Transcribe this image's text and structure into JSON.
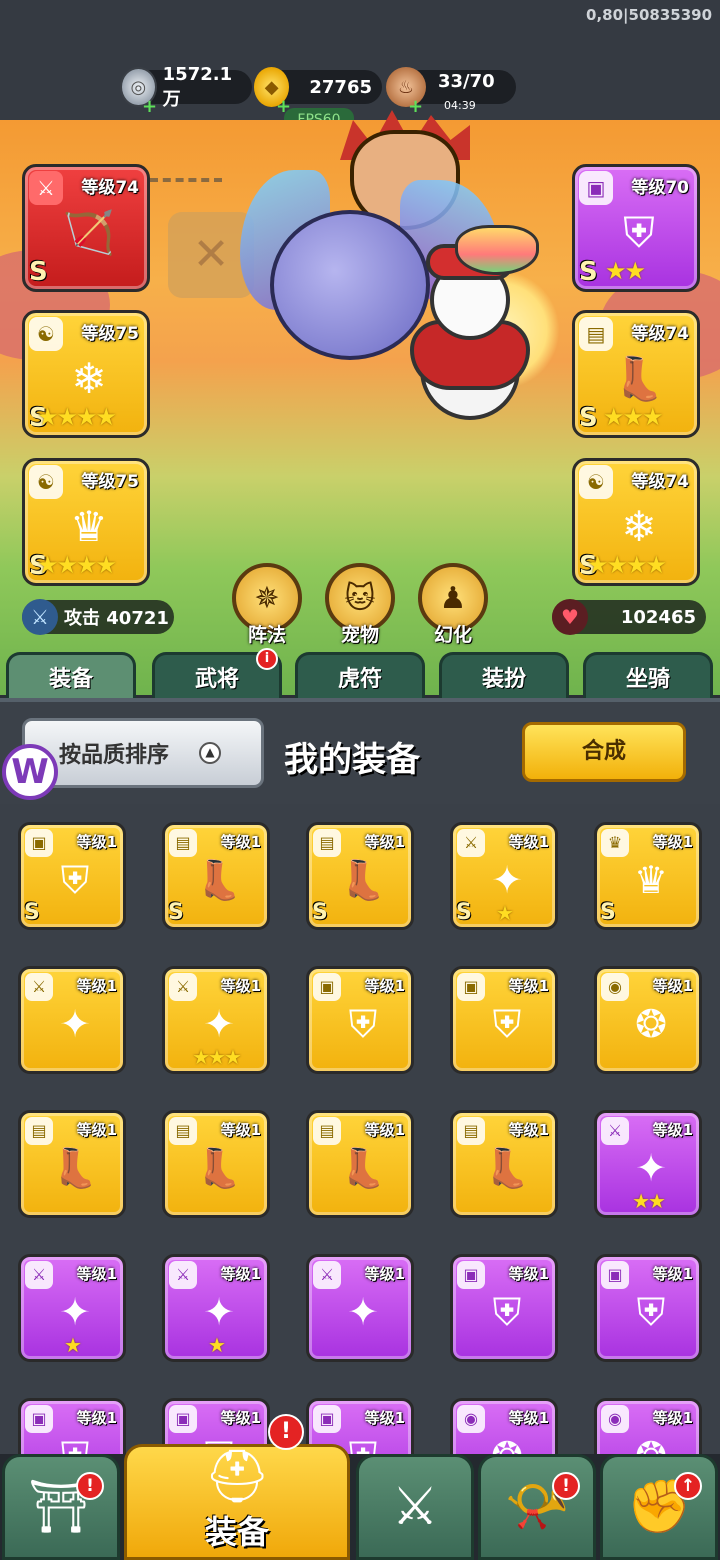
{
  "build_id": "0,80|50835390",
  "resources": {
    "silver": {
      "icon": "silver-coin-icon",
      "value": "1572.1万"
    },
    "gold": {
      "icon": "gold-ingot-icon",
      "value": "27765"
    },
    "food": {
      "icon": "meat-icon",
      "value": "33/70",
      "timer": "04:39"
    }
  },
  "fps": "FPS60",
  "equipped": {
    "left": [
      {
        "slot": "weapon",
        "level": "等级74",
        "grade": "S",
        "stars": "",
        "rarity": "red"
      },
      {
        "slot": "talisman",
        "level": "等级75",
        "grade": "S",
        "stars": "★★★★",
        "rarity": "gold"
      },
      {
        "slot": "talisman",
        "level": "等级75",
        "grade": "S",
        "stars": "★★★★",
        "rarity": "gold"
      }
    ],
    "right": [
      {
        "slot": "armor",
        "level": "等级70",
        "grade": "S",
        "stars": "★★",
        "rarity": "purple"
      },
      {
        "slot": "boots",
        "level": "等级74",
        "grade": "S",
        "stars": "★★★",
        "rarity": "gold"
      },
      {
        "slot": "talisman",
        "level": "等级74",
        "grade": "S",
        "stars": "★★★★",
        "rarity": "gold"
      }
    ]
  },
  "quick_buttons": [
    {
      "label": "阵法",
      "icon": "formation-icon"
    },
    {
      "label": "宠物",
      "icon": "pet-cat-icon"
    },
    {
      "label": "幻化",
      "icon": "transform-icon"
    }
  ],
  "stats": {
    "attack_label": "攻击 40721",
    "hp": "102465"
  },
  "subtabs": [
    {
      "label": "装备",
      "active": true,
      "badge": ""
    },
    {
      "label": "武将",
      "active": false,
      "badge": "i"
    },
    {
      "label": "虎符",
      "active": false,
      "badge": ""
    },
    {
      "label": "装扮",
      "active": false,
      "badge": ""
    },
    {
      "label": "坐骑",
      "active": false,
      "badge": ""
    }
  ],
  "panel": {
    "sort_label": "按品质排序",
    "title": "我的装备",
    "compose_label": "合成"
  },
  "inventory": [
    {
      "level": "等级1",
      "rarity": "gold",
      "grade": "S",
      "stars": "",
      "icon": "armor-icon"
    },
    {
      "level": "等级1",
      "rarity": "gold",
      "grade": "S",
      "stars": "",
      "icon": "boots-icon"
    },
    {
      "level": "等级1",
      "rarity": "gold",
      "grade": "S",
      "stars": "",
      "icon": "boots-icon"
    },
    {
      "level": "等级1",
      "rarity": "gold",
      "grade": "S",
      "stars": "★",
      "icon": "weapon-icon"
    },
    {
      "level": "等级1",
      "rarity": "gold",
      "grade": "S",
      "stars": "",
      "icon": "helmet-icon"
    },
    {
      "level": "等级1",
      "rarity": "gold",
      "grade": "",
      "stars": "",
      "icon": "weapon-icon"
    },
    {
      "level": "等级1",
      "rarity": "gold",
      "grade": "",
      "stars": "★★★",
      "icon": "weapon-icon"
    },
    {
      "level": "等级1",
      "rarity": "gold",
      "grade": "",
      "stars": "",
      "icon": "armor-icon"
    },
    {
      "level": "等级1",
      "rarity": "gold",
      "grade": "",
      "stars": "",
      "icon": "armor-icon"
    },
    {
      "level": "等级1",
      "rarity": "gold",
      "grade": "",
      "stars": "",
      "icon": "amulet-icon"
    },
    {
      "level": "等级1",
      "rarity": "gold",
      "grade": "",
      "stars": "",
      "icon": "boots-icon"
    },
    {
      "level": "等级1",
      "rarity": "gold",
      "grade": "",
      "stars": "",
      "icon": "boots-icon"
    },
    {
      "level": "等级1",
      "rarity": "gold",
      "grade": "",
      "stars": "",
      "icon": "boots-icon"
    },
    {
      "level": "等级1",
      "rarity": "gold",
      "grade": "",
      "stars": "",
      "icon": "boots-icon"
    },
    {
      "level": "等级1",
      "rarity": "purple",
      "grade": "",
      "stars": "★★",
      "icon": "weapon-icon"
    },
    {
      "level": "等级1",
      "rarity": "purple",
      "grade": "",
      "stars": "★",
      "icon": "weapon-icon"
    },
    {
      "level": "等级1",
      "rarity": "purple",
      "grade": "",
      "stars": "★",
      "icon": "weapon-icon"
    },
    {
      "level": "等级1",
      "rarity": "purple",
      "grade": "",
      "stars": "",
      "icon": "weapon-icon"
    },
    {
      "level": "等级1",
      "rarity": "purple",
      "grade": "",
      "stars": "",
      "icon": "armor-icon"
    },
    {
      "level": "等级1",
      "rarity": "purple",
      "grade": "",
      "stars": "",
      "icon": "armor-icon"
    },
    {
      "level": "等级1",
      "rarity": "purple",
      "grade": "",
      "stars": "",
      "icon": "armor-icon"
    },
    {
      "level": "等级1",
      "rarity": "purple",
      "grade": "",
      "stars": "",
      "icon": "armor-icon"
    },
    {
      "level": "等级1",
      "rarity": "purple",
      "grade": "",
      "stars": "",
      "icon": "armor-icon"
    },
    {
      "level": "等级1",
      "rarity": "purple",
      "grade": "",
      "stars": "",
      "icon": "amulet-icon"
    },
    {
      "level": "等级1",
      "rarity": "purple",
      "grade": "",
      "stars": "",
      "icon": "amulet-icon"
    }
  ],
  "bottom_nav": [
    {
      "label": "",
      "icon": "shop-gate-icon",
      "active": false,
      "badge": "!"
    },
    {
      "label": "装备",
      "icon": "helmet-icon",
      "active": true,
      "badge": "!"
    },
    {
      "label": "",
      "icon": "crossed-swords-icon",
      "active": false,
      "badge": ""
    },
    {
      "label": "",
      "icon": "horn-icon",
      "active": false,
      "badge": "!"
    },
    {
      "label": "",
      "icon": "upgrade-fist-icon",
      "active": false,
      "badge": "↑"
    }
  ]
}
